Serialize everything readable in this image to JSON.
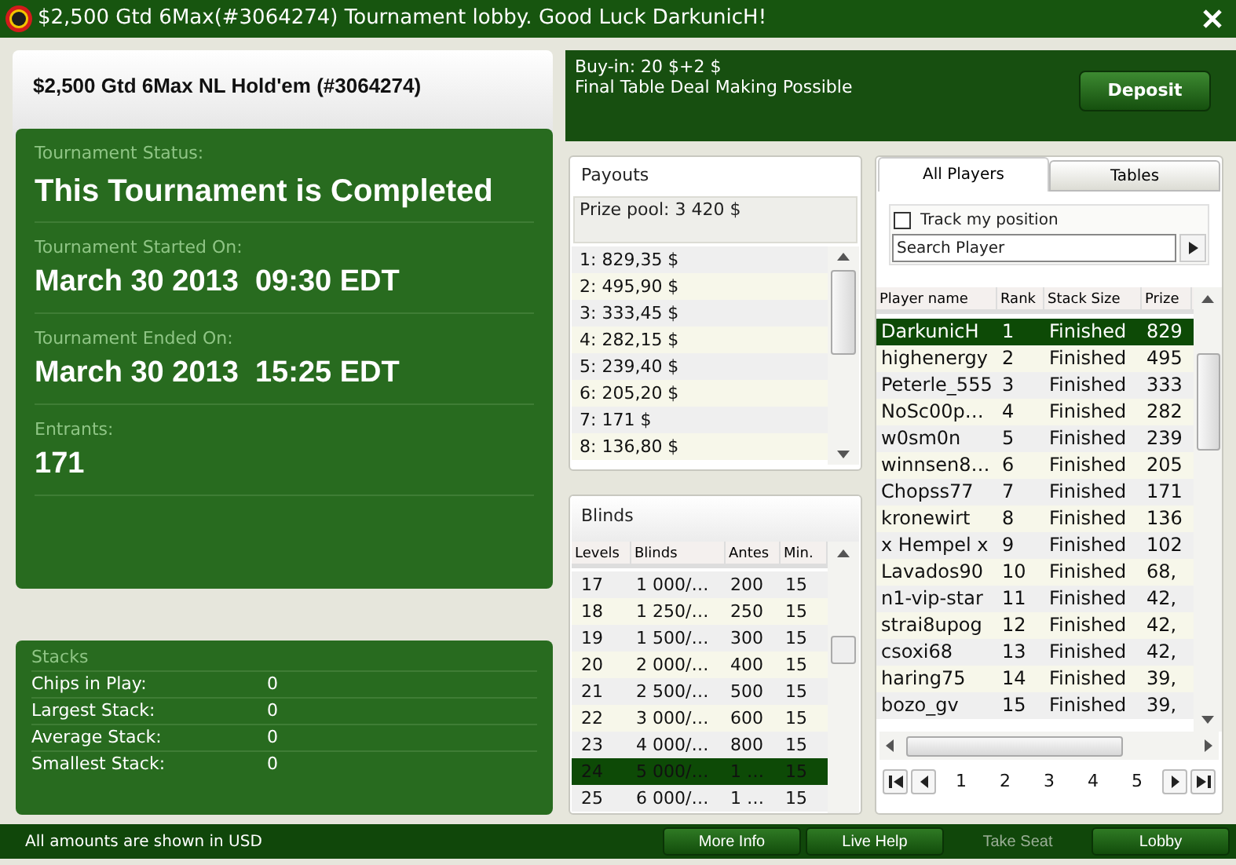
{
  "window": {
    "title": "$2,500 Gtd 6Max(#3064274) Tournament lobby. Good Luck DarkunicH!"
  },
  "tournament": {
    "name": "$2,500 Gtd 6Max NL Hold'em (#3064274)",
    "fields": [
      {
        "label": "Tournament Status:",
        "value": "This Tournament is Completed"
      },
      {
        "label": "Tournament Started On:",
        "value": "March 30 2013  09:30 EDT"
      },
      {
        "label": "Tournament Ended On:",
        "value": "March 30 2013  15:25 EDT"
      },
      {
        "label": "Entrants:",
        "value": "171"
      }
    ]
  },
  "stacks": {
    "title": "Stacks",
    "rows": [
      {
        "label": "Chips in Play:",
        "value": "0"
      },
      {
        "label": "Largest Stack:",
        "value": "0"
      },
      {
        "label": "Average Stack:",
        "value": "0"
      },
      {
        "label": "Smallest Stack:",
        "value": "0"
      }
    ]
  },
  "info": {
    "lines": [
      "Buy-in: 20 $+2 $",
      "Final Table Deal Making Possible"
    ],
    "deposit": "Deposit"
  },
  "payouts": {
    "title": "Payouts",
    "prize_pool": "Prize pool: 3 420 $",
    "rows": [
      "1: 829,35 $",
      "2: 495,90 $",
      "3: 333,45 $",
      "4: 282,15 $",
      "5: 239,40 $",
      "6: 205,20 $",
      "7: 171 $",
      "8: 136,80 $"
    ]
  },
  "blinds": {
    "title": "Blinds",
    "columns": [
      "Levels",
      "Blinds",
      "Antes",
      "Min."
    ],
    "rows": [
      {
        "cells": [
          "17",
          "1 000/…",
          "200",
          "15"
        ],
        "selected": false
      },
      {
        "cells": [
          "18",
          "1 250/…",
          "250",
          "15"
        ],
        "selected": false
      },
      {
        "cells": [
          "19",
          "1 500/…",
          "300",
          "15"
        ],
        "selected": false
      },
      {
        "cells": [
          "20",
          "2 000/…",
          "400",
          "15"
        ],
        "selected": false
      },
      {
        "cells": [
          "21",
          "2 500/…",
          "500",
          "15"
        ],
        "selected": false
      },
      {
        "cells": [
          "22",
          "3 000/…",
          "600",
          "15"
        ],
        "selected": false
      },
      {
        "cells": [
          "23",
          "4 000/…",
          "800",
          "15"
        ],
        "selected": false
      },
      {
        "cells": [
          "24",
          "5 000/…",
          "1 …",
          "15"
        ],
        "selected": true
      },
      {
        "cells": [
          "25",
          "6 000/…",
          "1 …",
          "15"
        ],
        "selected": false
      }
    ]
  },
  "players": {
    "tabs": [
      {
        "label": "All Players",
        "selected": true
      },
      {
        "label": "Tables",
        "selected": false
      }
    ],
    "track": {
      "label": "Track my position",
      "checked": false
    },
    "search": {
      "placeholder": "Search Player"
    },
    "columns": [
      "Player name",
      "Rank",
      "Stack Size",
      "Prize"
    ],
    "rows": [
      {
        "cells": [
          "DarkunicH",
          "1",
          "Finished",
          "829"
        ],
        "selected": true
      },
      {
        "cells": [
          "highenergy",
          "2",
          "Finished",
          "495"
        ],
        "selected": false
      },
      {
        "cells": [
          "Peterle_555",
          "3",
          "Finished",
          "333"
        ],
        "selected": false
      },
      {
        "cells": [
          "NoSc00p…",
          "4",
          "Finished",
          "282"
        ],
        "selected": false
      },
      {
        "cells": [
          "w0sm0n",
          "5",
          "Finished",
          "239"
        ],
        "selected": false
      },
      {
        "cells": [
          "winnsen8…",
          "6",
          "Finished",
          "205"
        ],
        "selected": false
      },
      {
        "cells": [
          "Chopss77",
          "7",
          "Finished",
          "171"
        ],
        "selected": false
      },
      {
        "cells": [
          "kronewirt",
          "8",
          "Finished",
          "136"
        ],
        "selected": false
      },
      {
        "cells": [
          "x Hempel x",
          "9",
          "Finished",
          "102"
        ],
        "selected": false
      },
      {
        "cells": [
          "Lavados90",
          "10",
          "Finished",
          "68,"
        ],
        "selected": false
      },
      {
        "cells": [
          "n1-vip-star",
          "11",
          "Finished",
          "42,"
        ],
        "selected": false
      },
      {
        "cells": [
          "strai8upog",
          "12",
          "Finished",
          "42,"
        ],
        "selected": false
      },
      {
        "cells": [
          "csoxi68",
          "13",
          "Finished",
          "42,"
        ],
        "selected": false
      },
      {
        "cells": [
          "haring75",
          "14",
          "Finished",
          "39,"
        ],
        "selected": false
      },
      {
        "cells": [
          "bozo_gv",
          "15",
          "Finished",
          "39,"
        ],
        "selected": false
      }
    ],
    "pages": [
      "1",
      "2",
      "3",
      "4",
      "5"
    ]
  },
  "status_bar": {
    "text": "All amounts are shown in USD",
    "buttons": [
      {
        "label": "More Info",
        "disabled": false
      },
      {
        "label": "Live Help",
        "disabled": false
      },
      {
        "label": "Take Seat",
        "disabled": true
      },
      {
        "label": "Lobby",
        "disabled": false
      }
    ]
  }
}
